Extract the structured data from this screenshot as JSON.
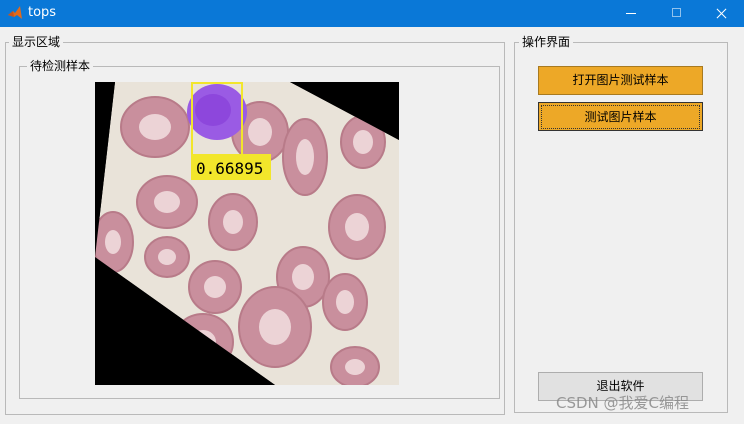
{
  "window": {
    "title": "tops",
    "app_icon": "matlab-icon",
    "controls": [
      "minimize-icon",
      "maximize-icon",
      "close-icon"
    ]
  },
  "display_panel": {
    "title": "显示区域",
    "sample_panel": {
      "title": "待检测样本",
      "detection": {
        "score": "0.66895",
        "box_color": "#f2e62b"
      }
    }
  },
  "ops_panel": {
    "title": "操作界面",
    "buttons": {
      "open_image": "打开图片测试样本",
      "test_image": "测试图片样本",
      "exit": "退出软件"
    }
  },
  "watermark": "CSDN @我爱C编程",
  "colors": {
    "titlebar": "#0a78d7",
    "button_accent": "#eda827",
    "button_default": "#e1e1e1"
  }
}
